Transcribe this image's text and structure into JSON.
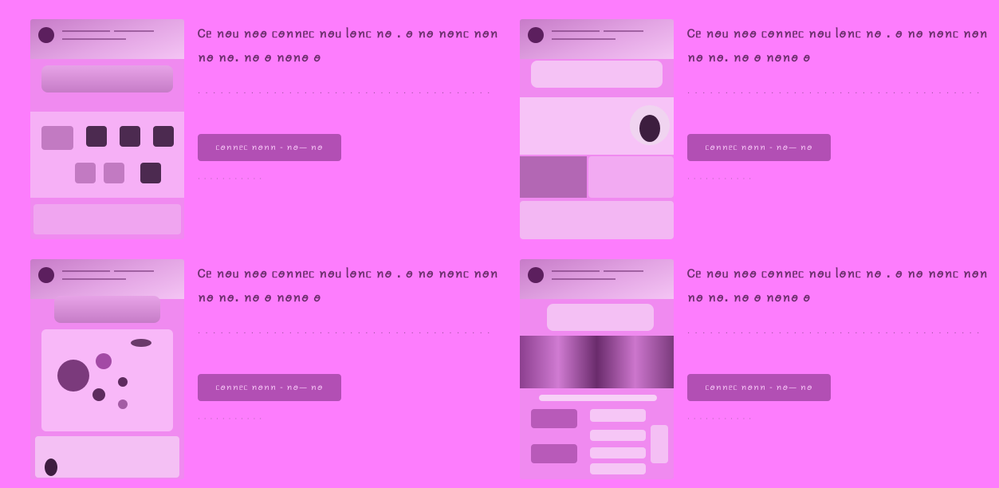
{
  "cards": [
    {
      "title": "Ꮯᥱ ꪀꪮᥙ ꪀꪮꪮ ᥴꪮꪀꪀᥱᥴ ꪀꪮᥙ ᥣꪮꪀᥴ ꪀꪮ . ꪮ ꪀꪮ ꪀꪮꪀᥴ ꪀꪮꪀ ꪀꪮ ꪀꪮ. ꪀꪮ ꪮ ꪀꪮꪀꪮ ꪮ",
      "description": "· · · · · · · · · · · · · · · · · · · · · · · · · · · · · · · · · · · · · · ·",
      "button_label": "ᥴꪮꪀꪀᥱᥴ ꪀꪮꪀꪀ - ꪀꪮ— ꪀꪮ",
      "meta": "· · · · · · · · · · ·"
    },
    {
      "title": "Ꮯᥱ ꪀꪮᥙ ꪀꪮꪮ ᥴꪮꪀꪀᥱᥴ ꪀꪮᥙ ᥣꪮꪀᥴ ꪀꪮ . ꪮ ꪀꪮ ꪀꪮꪀᥴ ꪀꪮꪀ ꪀꪮ ꪀꪮ. ꪀꪮ ꪮ ꪀꪮꪀꪮ ꪮ",
      "description": "· · · · · · · · · · · · · · · · · · · · · · · · · · · · · · · · · · · · · · ·",
      "button_label": "ᥴꪮꪀꪀᥱᥴ ꪀꪮꪀꪀ - ꪀꪮ— ꪀꪮ",
      "meta": "· · · · · · · · · · ·"
    },
    {
      "title": "Ꮯᥱ ꪀꪮᥙ ꪀꪮꪮ ᥴꪮꪀꪀᥱᥴ ꪀꪮᥙ ᥣꪮꪀᥴ ꪀꪮ . ꪮ ꪀꪮ ꪀꪮꪀᥴ ꪀꪮꪀ ꪀꪮ ꪀꪮ. ꪀꪮ ꪮ ꪀꪮꪀꪮ ꪮ",
      "description": "· · · · · · · · · · · · · · · · · · · · · · · · · · · · · · · · · · · · · · ·",
      "button_label": "ᥴꪮꪀꪀᥱᥴ ꪀꪮꪀꪀ - ꪀꪮ— ꪀꪮ",
      "meta": "· · · · · · · · · · ·"
    },
    {
      "title": "Ꮯᥱ ꪀꪮᥙ ꪀꪮꪮ ᥴꪮꪀꪀᥱᥴ ꪀꪮᥙ ᥣꪮꪀᥴ ꪀꪮ . ꪮ ꪀꪮ ꪀꪮꪀᥴ ꪀꪮꪀ ꪀꪮ ꪀꪮ. ꪀꪮ ꪮ ꪀꪮꪀꪮ ꪮ",
      "description": "· · · · · · · · · · · · · · · · · · · · · · · · · · · · · · · · · · · · · · ·",
      "button_label": "ᥴꪮꪀꪀᥱᥴ ꪀꪮꪀꪀ - ꪀꪮ— ꪀꪮ",
      "meta": "· · · · · · · · · · ·"
    }
  ],
  "colors": {
    "page_background": "#fd7dfd",
    "button": "#b24fb4",
    "title": "#6d2f6e"
  }
}
